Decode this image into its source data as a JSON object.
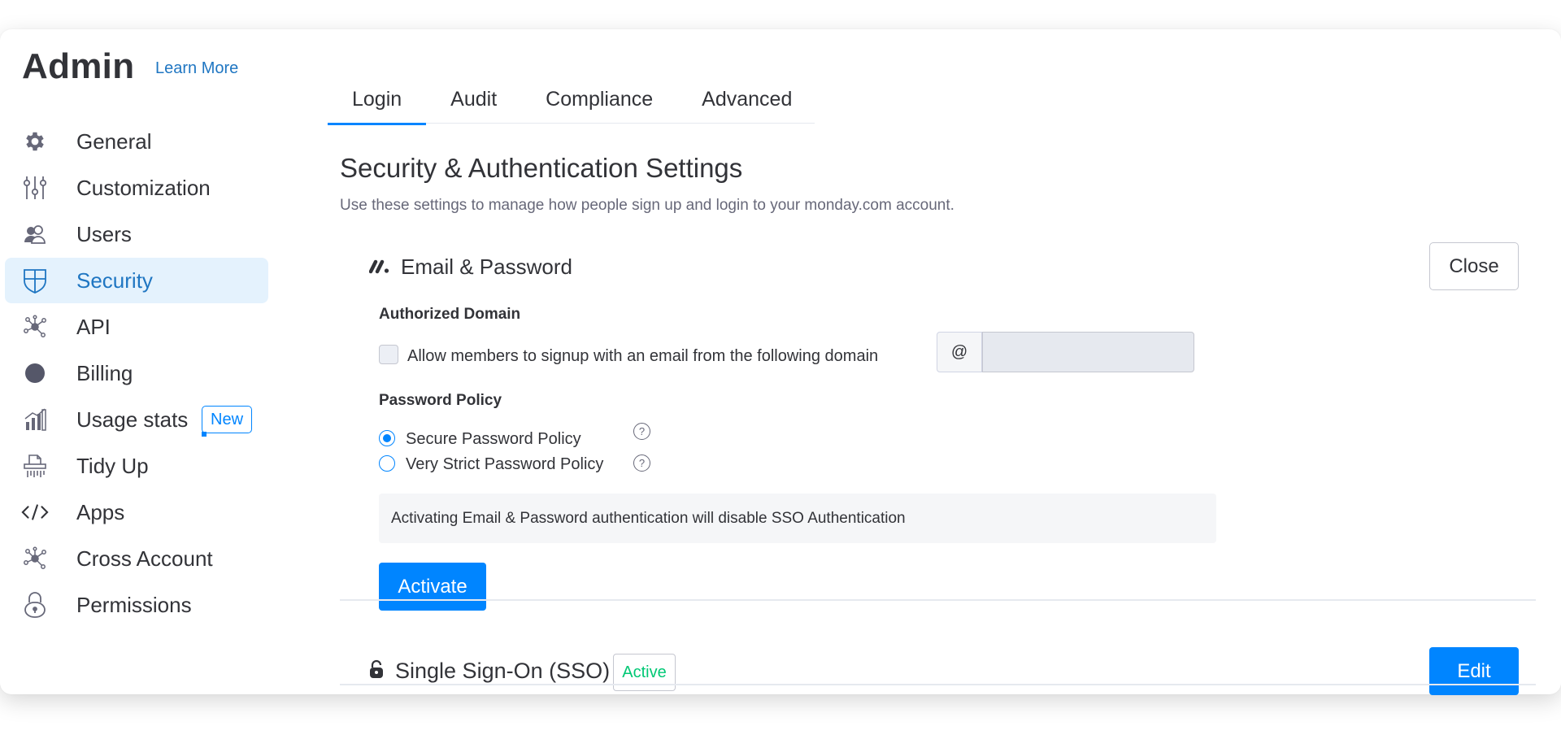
{
  "header": {
    "title": "Admin",
    "learn_more": "Learn More"
  },
  "sidebar": {
    "items": [
      {
        "label": "General",
        "icon": "gear-icon"
      },
      {
        "label": "Customization",
        "icon": "sliders-icon"
      },
      {
        "label": "Users",
        "icon": "users-icon"
      },
      {
        "label": "Security",
        "icon": "shield-icon",
        "active": true
      },
      {
        "label": "API",
        "icon": "network-icon"
      },
      {
        "label": "Billing",
        "icon": "circle-icon"
      },
      {
        "label": "Usage stats",
        "icon": "stats-icon",
        "badge": "New"
      },
      {
        "label": "Tidy Up",
        "icon": "shredder-icon"
      },
      {
        "label": "Apps",
        "icon": "code-icon"
      },
      {
        "label": "Cross Account",
        "icon": "network-icon"
      },
      {
        "label": "Permissions",
        "icon": "lock-icon"
      }
    ]
  },
  "tabs": [
    {
      "label": "Login",
      "active": true
    },
    {
      "label": "Audit"
    },
    {
      "label": "Compliance"
    },
    {
      "label": "Advanced"
    }
  ],
  "main": {
    "title": "Security & Authentication Settings",
    "subtitle": "Use these settings to manage how people sign up and login to your monday.com account.",
    "email_password": {
      "icon": "monday-logo-icon",
      "title": "Email & Password",
      "close_label": "Close",
      "authorized_domain_heading": "Authorized Domain",
      "allow_domain_label": "Allow members to signup with an email from the following domain",
      "allow_domain_checked": false,
      "at_symbol": "@",
      "domain_value": "",
      "password_policy_heading": "Password Policy",
      "policies": [
        {
          "label": "Secure Password Policy",
          "selected": true
        },
        {
          "label": "Very Strict Password Policy",
          "selected": false
        }
      ],
      "help_glyph": "?",
      "notice": "Activating Email & Password authentication will disable SSO Authentication",
      "activate_label": "Activate"
    },
    "sso": {
      "icon": "lock-icon",
      "title": "Single Sign-On (SSO)",
      "status": "Active",
      "edit_label": "Edit"
    }
  },
  "colors": {
    "accent": "#0085ff",
    "link": "#1f76c2",
    "active_bg": "#e4f2fd",
    "status_active": "#00c875",
    "text": "#323338",
    "muted": "#676879"
  }
}
